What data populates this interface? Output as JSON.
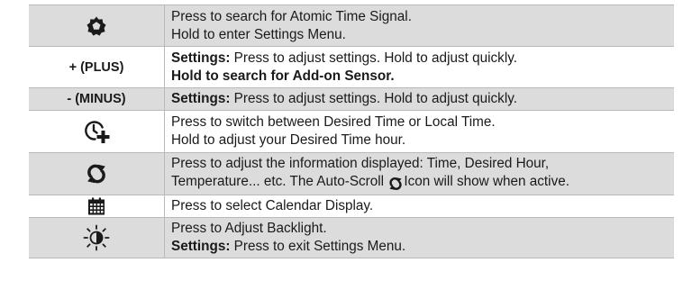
{
  "rows": [
    {
      "key_icon": "gear-icon",
      "lines": [
        {
          "plain": "Press to search for Atomic Time Signal."
        },
        {
          "plain": "Hold to enter Settings Menu."
        }
      ]
    },
    {
      "key_label": "+ (PLUS)",
      "lines": [
        {
          "bold": "Settings:",
          "plain": " Press to adjust settings. Hold to adjust quickly."
        },
        {
          "plain": "Hold to search for Add-on Sensor."
        }
      ]
    },
    {
      "key_label": "- (MINUS)",
      "lines": [
        {
          "bold": "Settings:",
          "plain": " Press to adjust settings. Hold to adjust quickly."
        }
      ]
    },
    {
      "key_icon": "clock-plus-icon",
      "lines": [
        {
          "plain": "Press to switch between Desired Time or Local Time."
        },
        {
          "plain": "Hold to adjust your Desired Time hour."
        }
      ]
    },
    {
      "key_icon": "auto-scroll-icon",
      "lines": [
        {
          "plain": "Press to adjust the information displayed: Time, Desired Hour,"
        },
        {
          "plain_before_icon": "Temperature... etc. The Auto-Scroll ",
          "inline_icon": "auto-scroll-icon",
          "plain_after_icon": "Icon will show when active."
        }
      ]
    },
    {
      "key_icon": "calendar-icon",
      "lines": [
        {
          "plain": "Press to select Calendar Display."
        }
      ]
    },
    {
      "key_icon": "backlight-icon",
      "lines": [
        {
          "plain": "Press to Adjust Backlight."
        },
        {
          "bold": "Settings:",
          "plain": " Press to exit Settings Menu."
        }
      ]
    }
  ],
  "colors": {
    "shade": "#dcdcdc",
    "border": "#b9b9b9",
    "text": "#1a1a1a"
  }
}
